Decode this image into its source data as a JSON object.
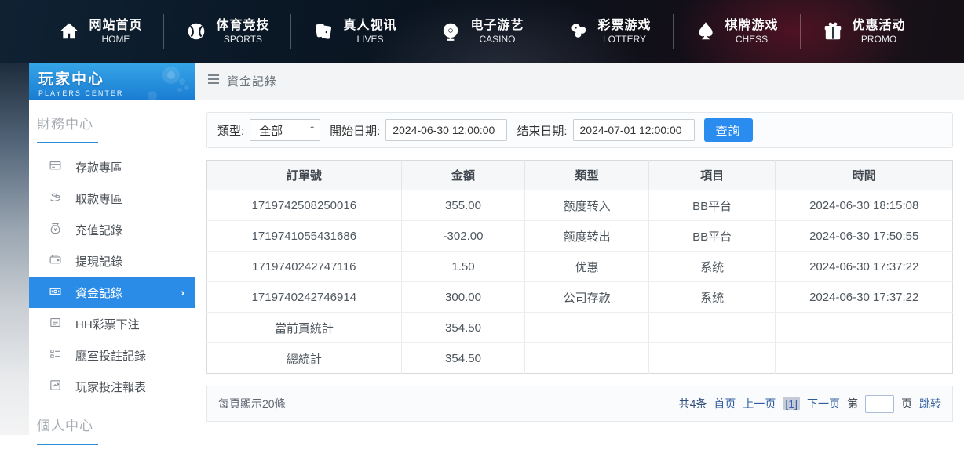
{
  "nav": {
    "items": [
      {
        "icon": "home-icon",
        "title": "网站首页",
        "subtitle": "HOME"
      },
      {
        "icon": "sports-icon",
        "title": "体育竞技",
        "subtitle": "SPORTS"
      },
      {
        "icon": "lives-icon",
        "title": "真人视讯",
        "subtitle": "LIVES"
      },
      {
        "icon": "casino-icon",
        "title": "电子游艺",
        "subtitle": "CASINO"
      },
      {
        "icon": "lottery-icon",
        "title": "彩票游戏",
        "subtitle": "LOTTERY"
      },
      {
        "icon": "chess-icon",
        "title": "棋牌游戏",
        "subtitle": "CHESS"
      },
      {
        "icon": "promo-icon",
        "title": "优惠活动",
        "subtitle": "PROMO"
      }
    ]
  },
  "sidebar": {
    "title": "玩家中心",
    "subtitle": "PLAYERS CENTER",
    "sections": [
      {
        "label": "財務中心",
        "items": [
          {
            "icon": "deposit-icon",
            "label": "存款專區",
            "active": false
          },
          {
            "icon": "withdraw-icon",
            "label": "取款專區",
            "active": false
          },
          {
            "icon": "recharge-icon",
            "label": "充值記錄",
            "active": false
          },
          {
            "icon": "cashout-icon",
            "label": "提現記錄",
            "active": false
          },
          {
            "icon": "funds-icon",
            "label": "資金記錄",
            "active": true
          },
          {
            "icon": "lottery-bet-icon",
            "label": "HH彩票下注",
            "active": false
          },
          {
            "icon": "hall-bet-icon",
            "label": "廳室投註記錄",
            "active": false
          },
          {
            "icon": "report-icon",
            "label": "玩家投注報表",
            "active": false
          }
        ]
      },
      {
        "label": "個人中心",
        "items": []
      }
    ]
  },
  "breadcrumb": {
    "title": "資金記錄"
  },
  "filter": {
    "type_label": "類型:",
    "type_value": "全部",
    "start_label": "開始日期:",
    "start_value": "2024-06-30 12:00:00",
    "end_label": "结束日期:",
    "end_value": "2024-07-01 12:00:00",
    "search_label": "查詢"
  },
  "table": {
    "headers": [
      "訂單號",
      "金額",
      "類型",
      "項目",
      "時間"
    ],
    "rows": [
      [
        "1719742508250016",
        "355.00",
        "额度转入",
        "BB平台",
        "2024-06-30 18:15:08"
      ],
      [
        "1719741055431686",
        "-302.00",
        "额度转出",
        "BB平台",
        "2024-06-30 17:50:55"
      ],
      [
        "1719740242747116",
        "1.50",
        "优惠",
        "系统",
        "2024-06-30 17:37:22"
      ],
      [
        "1719740242746914",
        "300.00",
        "公司存款",
        "系统",
        "2024-06-30 17:37:22"
      ],
      [
        "當前頁統計",
        "354.50",
        "",
        "",
        ""
      ],
      [
        "總統計",
        "354.50",
        "",
        "",
        ""
      ]
    ]
  },
  "pagination": {
    "per_page": "每頁顯示20條",
    "total": "共4条",
    "first": "首页",
    "prev": "上一页",
    "current": "[1]",
    "next": "下一页",
    "page_prefix": "第",
    "page_suffix": "页",
    "jump": "跳转",
    "page_input_value": ""
  },
  "colors": {
    "accent_blue": "#2b8cf0",
    "sidebar_active": "#2b8ce8",
    "header_gradient_top": "#36a5e8",
    "header_gradient_bottom": "#1a7cd2",
    "link_blue": "#2f5d9e"
  }
}
